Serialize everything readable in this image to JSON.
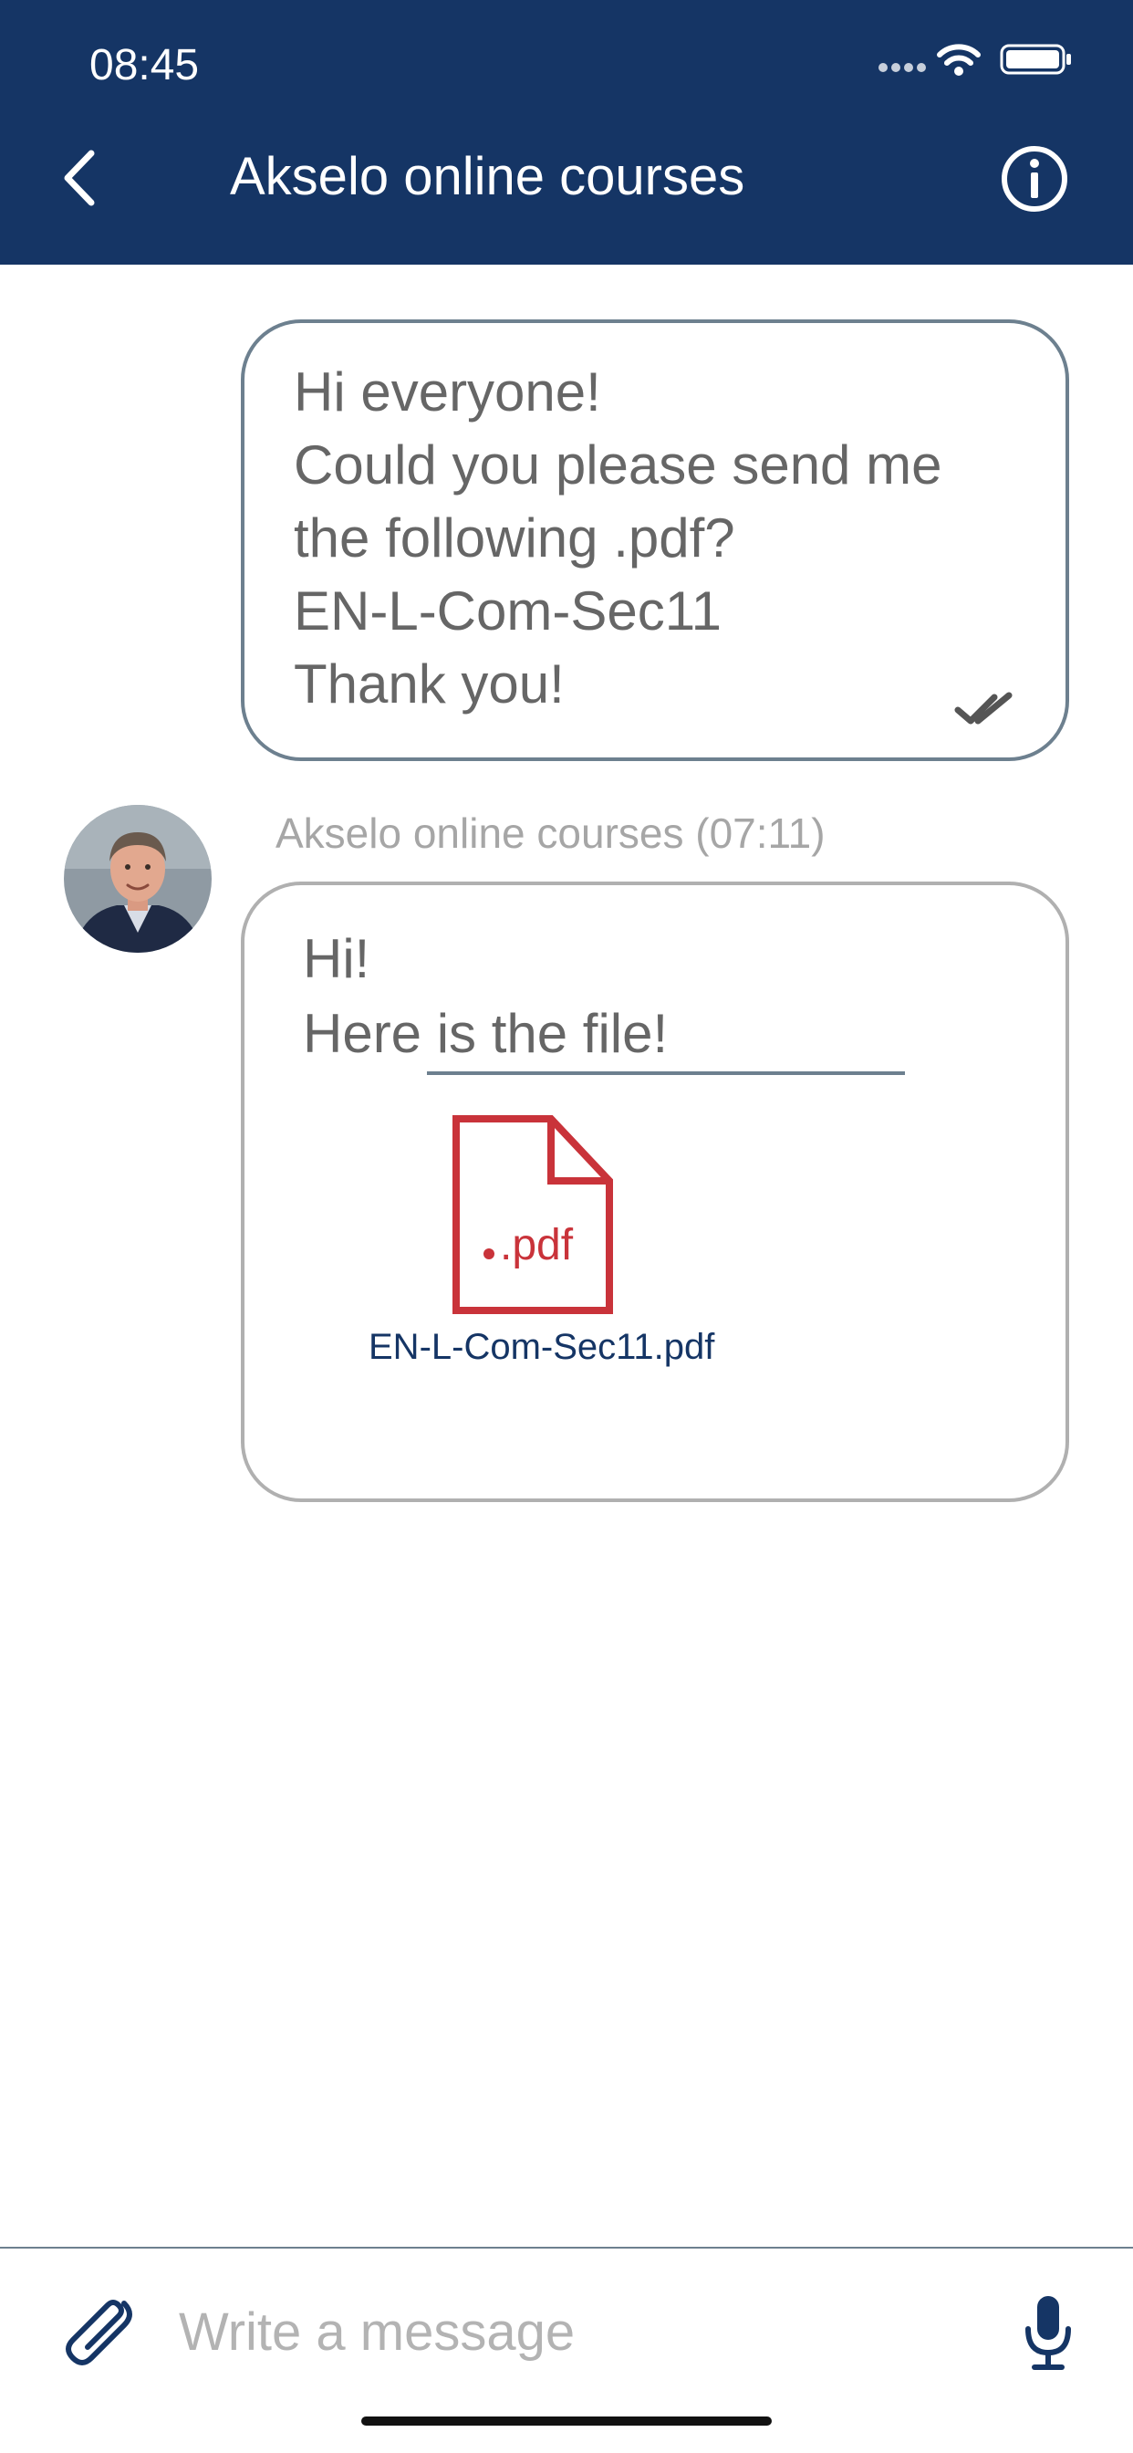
{
  "status_bar": {
    "time": "08:45"
  },
  "header": {
    "title": "Akselo online courses",
    "back_icon": "chevron-left-icon",
    "info_icon": "info-circle-icon"
  },
  "messages": {
    "outgoing": {
      "lines": [
        "Hi everyone!",
        "Could you please send me",
        "the following .pdf?",
        "EN-L-Com-Sec11",
        "Thank you!"
      ],
      "status_icon": "double-check-icon"
    },
    "incoming": {
      "sender_line": "Akselo online courses (07:11)",
      "lines": [
        "Hi!",
        "Here is the file!"
      ],
      "attachment": {
        "icon_label": ".pdf",
        "filename": "EN-L-Com-Sec11.pdf"
      }
    }
  },
  "composer": {
    "placeholder": "Write a message",
    "attach_icon": "paperclip-icon",
    "mic_icon": "microphone-icon"
  },
  "colors": {
    "header_bg": "#153565",
    "accent_red": "#c9333a",
    "bubble_border_out": "#6d808f",
    "bubble_border_in": "#b0b0b0"
  }
}
